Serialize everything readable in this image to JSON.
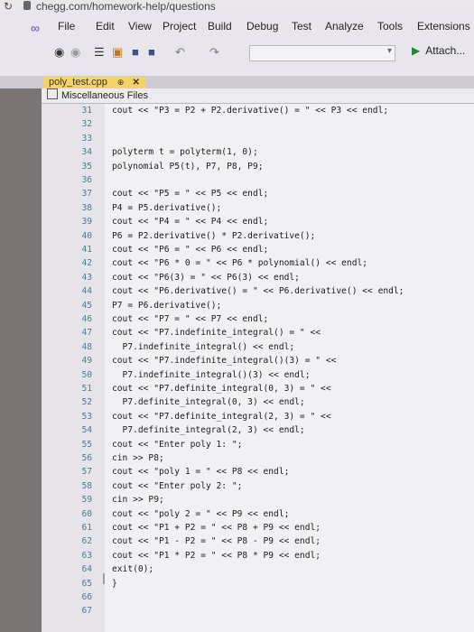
{
  "browser": {
    "url": "chegg.com/homework-help/questions"
  },
  "menu": [
    "File",
    "Edit",
    "View",
    "Project",
    "Build",
    "Debug",
    "Test",
    "Analyze",
    "Tools",
    "Extensions"
  ],
  "toolbar": {
    "attach_label": "Attach..."
  },
  "tab": {
    "filename": "poly_test.cpp"
  },
  "scope": {
    "label": "Miscellaneous Files"
  },
  "code_lines": [
    {
      "n": "31",
      "t": "cout << \"P3 = P2 + P2.derivative() = \" << P3 << endl;"
    },
    {
      "n": "32",
      "t": ""
    },
    {
      "n": "33",
      "t": ""
    },
    {
      "n": "34",
      "t": "polyterm t = polyterm(1, 0);"
    },
    {
      "n": "35",
      "t": "polynomial P5(t), P7, P8, P9;"
    },
    {
      "n": "36",
      "t": ""
    },
    {
      "n": "37",
      "t": "cout << \"P5 = \" << P5 << endl;"
    },
    {
      "n": "38",
      "t": "P4 = P5.derivative();"
    },
    {
      "n": "39",
      "t": "cout << \"P4 = \" << P4 << endl;"
    },
    {
      "n": "40",
      "t": "P6 = P2.derivative() * P2.derivative();"
    },
    {
      "n": "41",
      "t": "cout << \"P6 = \" << P6 << endl;"
    },
    {
      "n": "42",
      "t": "cout << \"P6 * 0 = \" << P6 * polynomial() << endl;"
    },
    {
      "n": "43",
      "t": "cout << \"P6(3) = \" << P6(3) << endl;"
    },
    {
      "n": "44",
      "t": "cout << \"P6.derivative() = \" << P6.derivative() << endl;"
    },
    {
      "n": "45",
      "t": "P7 = P6.derivative();"
    },
    {
      "n": "46",
      "t": "cout << \"P7 = \" << P7 << endl;"
    },
    {
      "n": "47",
      "t": "cout << \"P7.indefinite_integral() = \" <<"
    },
    {
      "n": "48",
      "t": "  P7.indefinite_integral() << endl;"
    },
    {
      "n": "49",
      "t": "cout << \"P7.indefinite_integral()(3) = \" <<"
    },
    {
      "n": "50",
      "t": "  P7.indefinite_integral()(3) << endl;"
    },
    {
      "n": "51",
      "t": "cout << \"P7.definite_integral(0, 3) = \" <<"
    },
    {
      "n": "52",
      "t": "  P7.definite_integral(0, 3) << endl;"
    },
    {
      "n": "53",
      "t": "cout << \"P7.definite_integral(2, 3) = \" <<"
    },
    {
      "n": "54",
      "t": "  P7.definite_integral(2, 3) << endl;"
    },
    {
      "n": "55",
      "t": "cout << \"Enter poly 1: \";"
    },
    {
      "n": "56",
      "t": "cin >> P8;"
    },
    {
      "n": "57",
      "t": "cout << \"poly 1 = \" << P8 << endl;"
    },
    {
      "n": "58",
      "t": "cout << \"Enter poly 2: \";"
    },
    {
      "n": "59",
      "t": "cin >> P9;"
    },
    {
      "n": "60",
      "t": "cout << \"poly 2 = \" << P9 << endl;"
    },
    {
      "n": "61",
      "t": "cout << \"P1 + P2 = \" << P8 + P9 << endl;"
    },
    {
      "n": "62",
      "t": "cout << \"P1 - P2 = \" << P8 - P9 << endl;"
    },
    {
      "n": "63",
      "t": "cout << \"P1 * P2 = \" << P8 * P9 << endl;"
    },
    {
      "n": "64",
      "t": "exit(0);"
    },
    {
      "n": "65",
      "t": "}"
    },
    {
      "n": "66",
      "t": ""
    },
    {
      "n": "67",
      "t": ""
    }
  ]
}
